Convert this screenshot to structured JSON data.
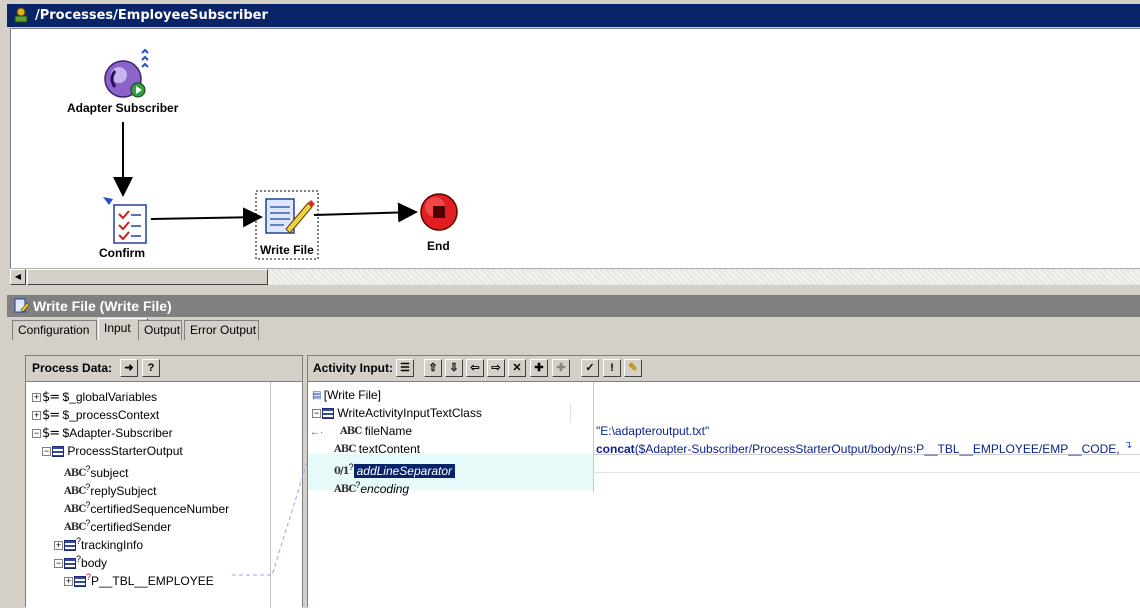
{
  "process_window": {
    "title": "/Processes/EmployeeSubscriber",
    "nodes": {
      "adapter_subscriber": "Adapter Subscriber",
      "confirm": "Confirm",
      "write_file": "Write File",
      "end": "End"
    }
  },
  "properties": {
    "title": "Write File (Write File)",
    "tabs": [
      "Configuration",
      "Input",
      "Output",
      "Error Output"
    ],
    "active_tab": "Input"
  },
  "process_data": {
    "label": "Process Data:",
    "tree": [
      {
        "label": "$_globalVariables"
      },
      {
        "label": "$_processContext"
      },
      {
        "label": "$Adapter-Subscriber"
      },
      {
        "label": "ProcessStarterOutput"
      },
      {
        "label": "subject"
      },
      {
        "label": "replySubject"
      },
      {
        "label": "certifiedSequenceNumber"
      },
      {
        "label": "certifiedSender"
      },
      {
        "label": "trackingInfo"
      },
      {
        "label": "body"
      },
      {
        "label": "P__TBL__EMPLOYEE"
      }
    ]
  },
  "activity_input": {
    "label": "Activity Input:",
    "rows": [
      {
        "name": "[Write File]",
        "value": ""
      },
      {
        "name": "WriteActivityInputTextClass",
        "value": ""
      },
      {
        "name": "fileName",
        "value": "\"E:\\adapteroutput.txt\""
      },
      {
        "name": "textContent",
        "value_keyword": "concat",
        "value": "($Adapter-Subscriber/ProcessStarterOutput/body/ns:P__TBL__EMPLOYEE/EMP__CODE,"
      },
      {
        "name": "addLineSeparator",
        "value": ""
      },
      {
        "name": "encoding",
        "value": ""
      }
    ]
  }
}
